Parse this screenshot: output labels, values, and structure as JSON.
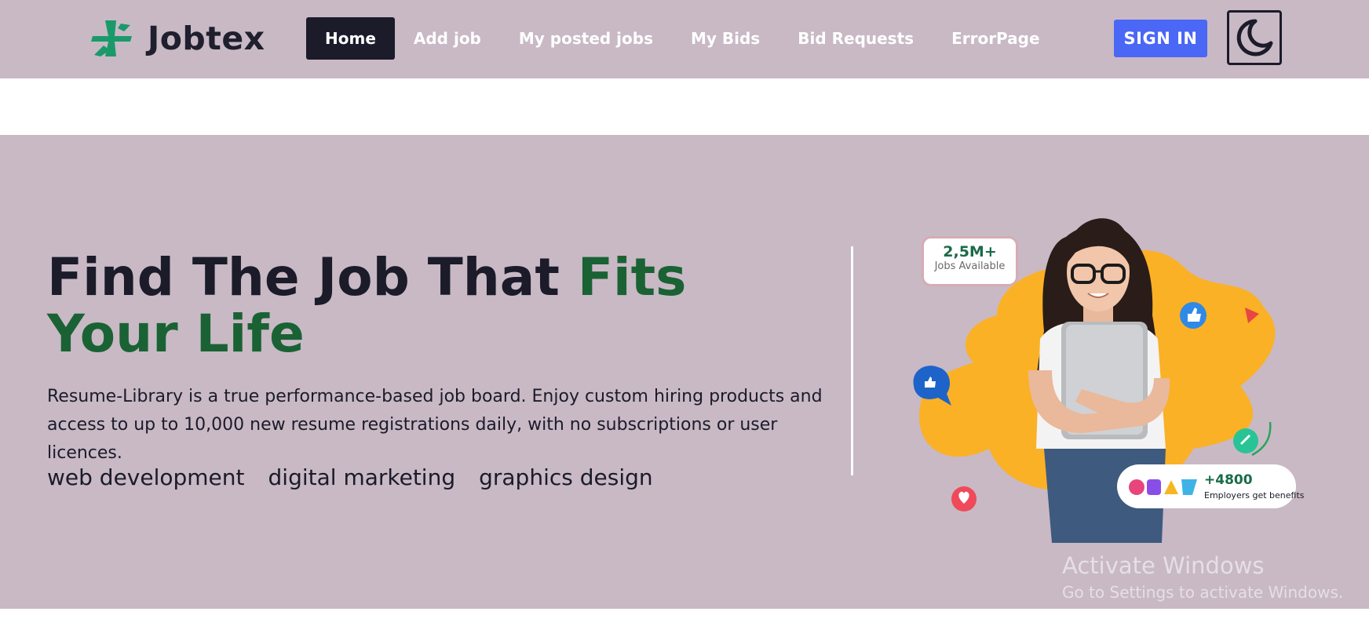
{
  "brand": {
    "name": "Jobtex"
  },
  "nav": {
    "items": [
      {
        "label": "Home",
        "active": true
      },
      {
        "label": "Add job"
      },
      {
        "label": "My posted jobs"
      },
      {
        "label": "My Bids"
      },
      {
        "label": "Bid Requests"
      },
      {
        "label": "ErrorPage"
      }
    ],
    "signin_label": "SIGN IN",
    "theme_icon": "moon-icon"
  },
  "hero": {
    "headline_part1": "Find The Job That ",
    "headline_accent": "Fits Your Life",
    "description": "Resume-Library is a true performance-based job board. Enjoy custom hiring products and access to up to 10,000 new resume registrations daily, with no subscriptions or user licences.",
    "tags": [
      "web development",
      "digital marketing",
      "graphics design"
    ],
    "stat": {
      "value": "2,5M+",
      "label": "Jobs Available"
    },
    "employers": {
      "count": "+4800",
      "label": "Employers get benefits"
    }
  },
  "watermark": {
    "title": "Activate Windows",
    "subtitle": "Go to Settings to activate Windows."
  },
  "colors": {
    "nav_bg": "#c8b9c5",
    "hero_bg": "#c8b9c5",
    "active_nav": "#1b1b2a",
    "signin": "#4b67f5",
    "accent_green": "#1a6234",
    "blob": "#fbb125"
  }
}
